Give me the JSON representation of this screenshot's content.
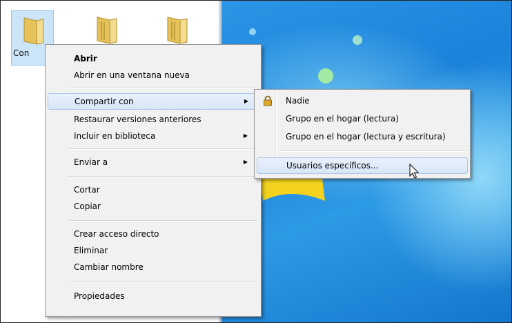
{
  "explorer": {
    "folders": [
      {
        "label": "Con",
        "selected": true
      },
      {
        "label": "",
        "selected": false
      },
      {
        "label": "",
        "selected": false
      }
    ]
  },
  "context_menu": {
    "items": [
      {
        "label": "Abrir",
        "bold": true
      },
      {
        "label": "Abrir en una ventana nueva"
      },
      {
        "label": "Compartir con",
        "submenu": true,
        "highlighted": true
      },
      {
        "label": "Restaurar versiones anteriores"
      },
      {
        "label": "Incluir en biblioteca",
        "submenu": true
      },
      {
        "label": "Enviar a",
        "submenu": true
      },
      {
        "label": "Cortar"
      },
      {
        "label": "Copiar"
      },
      {
        "label": "Crear acceso directo"
      },
      {
        "label": "Eliminar"
      },
      {
        "label": "Cambiar nombre"
      },
      {
        "label": "Propiedades"
      }
    ]
  },
  "share_submenu": {
    "items": [
      {
        "label": "Nadie",
        "icon": "lock-icon"
      },
      {
        "label": "Grupo en el hogar (lectura)"
      },
      {
        "label": "Grupo en el hogar (lectura y escritura)"
      },
      {
        "label": "Usuarios específicos...",
        "highlighted": true
      }
    ]
  },
  "colors": {
    "menu_background": "#f1f1f1",
    "highlight": "#d7e6f8",
    "desktop_blue": "#1a82da"
  }
}
